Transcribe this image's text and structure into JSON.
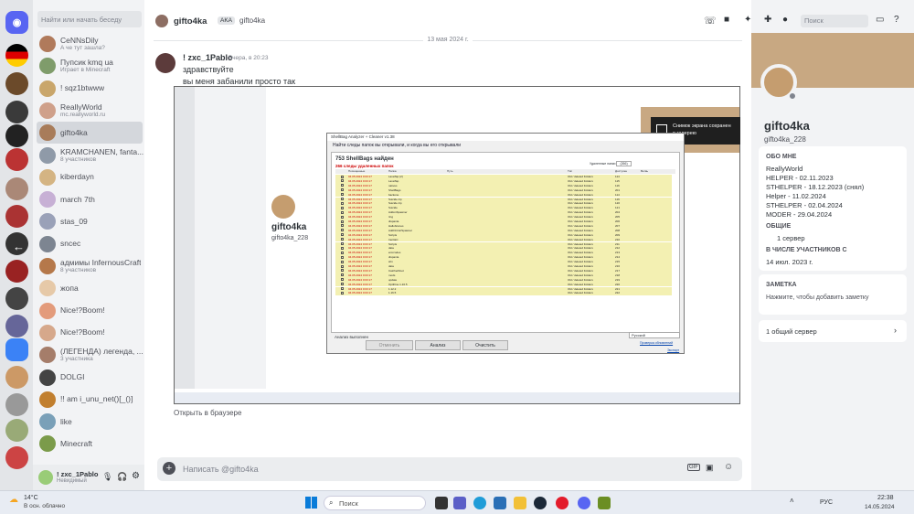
{
  "dm_list": {
    "search_placeholder": "Найти или начать беседу",
    "items": [
      {
        "name": "CeNNsDily",
        "sub": "А че тут зашла?"
      },
      {
        "name": "Пупсик kmq ua",
        "sub": "Играет в Minecraft"
      },
      {
        "name": "! sqz1btwww",
        "sub": ""
      },
      {
        "name": "ReallyWorld",
        "sub": "mc.reallyworld.ru"
      },
      {
        "name": "gifto4ka",
        "sub": ""
      },
      {
        "name": "KRAMCHANEN, fanta...",
        "sub": "8 участников"
      },
      {
        "name": "kiberdayn",
        "sub": ""
      },
      {
        "name": "march 7th",
        "sub": ""
      },
      {
        "name": "stas_09",
        "sub": ""
      },
      {
        "name": "sncec",
        "sub": ""
      },
      {
        "name": "адмимы InfernousCraft",
        "sub": "8 участников"
      },
      {
        "name": "жопа",
        "sub": ""
      },
      {
        "name": "Nice!?Boom!",
        "sub": ""
      },
      {
        "name": "Nice!?Boom!",
        "sub": ""
      },
      {
        "name": "(ЛЕГЕНДА) легенда, ...",
        "sub": "3 участника"
      },
      {
        "name": "DOLGI",
        "sub": ""
      },
      {
        "name": "!! am i_unu_net()[_()]",
        "sub": ""
      },
      {
        "name": "like",
        "sub": ""
      },
      {
        "name": "Minecraft",
        "sub": ""
      }
    ],
    "user_name": "! zxc_1Pablo",
    "user_status": "Невидимый"
  },
  "header": {
    "channel_name": "gifto4ka",
    "aka_label": "AKA",
    "aka_name": "gifto4ka",
    "search_placeholder": "Поиск"
  },
  "chat": {
    "date_divider": "13 мая 2024 г.",
    "author": "! zxc_1Pablo",
    "timestamp": "Вчера, в 20:23",
    "line1": "здравствуйте",
    "line2": "вы меня забанили просто так",
    "composer_placeholder": "Написать @gifto4ka",
    "open_in_browser": "Открыть в браузере"
  },
  "profile": {
    "display_name": "gifto4ka",
    "username": "gifto4ka_228",
    "about_title": "ОБО МНЕ",
    "about_lines": [
      "ReallyWorld",
      "HELPER - 02.11.2023",
      "STHELPER - 18.12.2023 (снял)",
      "Helper - 11.02.2024",
      "STHELPER - 02.04.2024",
      "MODER - 29.04.2024"
    ],
    "common_title": "ОБЩИЕ",
    "common_server": "1 сервер",
    "member_since_title": "В ЧИСЛЕ УЧАСТНИКОВ С",
    "member_since": "14 июл. 2023 г.",
    "note_title": "ЗАМЕТКА",
    "note_placeholder": "Нажмите, чтобы добавить заметку",
    "mutual_servers": "1 общий сервер"
  },
  "screenshot_toast": {
    "line1": "Снимок экрана сохранен",
    "line2": "в галерею"
  },
  "shellbag": {
    "window_title": "ShellBag Analyzer + Cleaner v1.38",
    "subtitle": "Найти следы папок вы открывали, и когда вы его открывали",
    "found": "753 ShellBags найден",
    "deleted": "266 следы удаленных папок",
    "deleted_label": "Удаленные папки",
    "deleted_count": "(266)",
    "columns": [
      "Посещенные",
      "Папка",
      "Путь",
      "Тип",
      "Доступен",
      "Ветвь"
    ],
    "rows": [
      {
        "date": "04.05.2024 0:03:17",
        "folder": "LavaTap (2)",
        "type": "Old / deleted Folders",
        "n": "114"
      },
      {
        "date": "04.05.2024 0:03:17",
        "folder": "LavaTap",
        "type": "Old / deleted Folders",
        "n": "115"
      },
      {
        "date": "04.05.2024 0:03:17",
        "folder": "natives",
        "type": "Old / deleted Folders",
        "n": "116"
      },
      {
        "date": "04.05.2024 0:03:17",
        "folder": "ShellBags",
        "type": "Old / deleted Folders",
        "n": "201"
      },
      {
        "date": "04.05.2024 0:03:17",
        "folder": "backone",
        "type": "Old / deleted Folders",
        "n": "114"
      },
      {
        "date": "04.05.2024 0:03:17",
        "folder": "Suicide.zip",
        "type": "Old / deleted Folders",
        "n": "119"
      },
      {
        "date": "04.05.2024 0:03:17",
        "folder": "Suicide.zip",
        "type": "Old / deleted Folders",
        "n": "120"
      },
      {
        "date": "04.05.2024 0:03:17",
        "folder": "Suicide",
        "type": "Old / deleted Folders",
        "n": "121"
      },
      {
        "date": "04.05.2024 0:03:17",
        "folder": "AddonSpawner",
        "type": "Old / deleted Folders",
        "n": "204"
      },
      {
        "date": "04.05.2024 0:03:17",
        "folder": "ring",
        "type": "Old / deleted Folders",
        "n": "205"
      },
      {
        "date": "04.05.2024 0:03:17",
        "folder": "dispanta",
        "type": "Old / deleted Folders",
        "n": "206"
      },
      {
        "date": "04.05.2024 0:03:17",
        "folder": "Hallofstones",
        "type": "Old / deleted Folders",
        "n": "207"
      },
      {
        "date": "04.05.2024 0:03:17",
        "folder": "AddOnCarSpawner",
        "type": "Old / deleted Folders",
        "n": "208"
      },
      {
        "date": "04.05.2024 0:03:17",
        "folder": "Scripts",
        "type": "Old / deleted Folders",
        "n": "209"
      },
      {
        "date": "04.05.2024 0:03:17",
        "folder": "InertiaC",
        "type": "Old / deleted Folders",
        "n": "210"
      },
      {
        "date": "04.05.2024 0:03:17",
        "folder": "Scripts",
        "type": "Old / deleted Folders",
        "n": "211"
      },
      {
        "date": "04.05.2024 0:03:17",
        "folder": "data",
        "type": "Old / deleted Folders",
        "n": "212"
      },
      {
        "date": "04.05.2024 0:03:17",
        "folder": "erorcodes",
        "type": "Old / deleted Folders",
        "n": "213"
      },
      {
        "date": "04.05.2024 0:03:17",
        "folder": "dispanta",
        "type": "Old / deleted Folders",
        "n": "214"
      },
      {
        "date": "04.05.2024 0:03:17",
        "folder": "sfm",
        "type": "Old / deleted Folders",
        "n": "215"
      },
      {
        "date": "04.05.2024 0:03:17",
        "folder": "data",
        "type": "Old / deleted Folders",
        "n": "216"
      },
      {
        "date": "04.05.2024 0:03:17",
        "folder": "CatcherRoot",
        "type": "Old / deleted Folders",
        "n": "217"
      },
      {
        "date": "04.05.2024 0:03:17",
        "folder": "mods",
        "type": "Old / deleted Folders",
        "n": "218"
      },
      {
        "date": "04.05.2024 0:03:17",
        "folder": "update",
        "type": "Old / deleted Folders",
        "n": "219"
      },
      {
        "date": "04.05.2024 0:03:17",
        "folder": "OptiFine 1.16.5",
        "type": "Old / deleted Folders",
        "n": "220"
      },
      {
        "date": "04.05.2024 0:03:17",
        "folder": "1.12.2",
        "type": "Old / deleted Folders",
        "n": "221"
      },
      {
        "date": "04.05.2024 0:03:17",
        "folder": "1.16.5",
        "type": "Old / deleted Folders",
        "n": "222"
      }
    ],
    "status": "Анализ выполнен",
    "btn_cancel": "Отменить",
    "btn_analyze": "Анализ",
    "btn_clean": "Очистить",
    "language": "Русский",
    "check_updates": "Проверка обновлений",
    "export": "Экспорт"
  },
  "taskbar": {
    "weather_temp": "14°C",
    "weather_desc": "В осн. облачно",
    "search_placeholder": "Поиск",
    "lang": "РУС",
    "time": "22:38",
    "date": "14.05.2024"
  },
  "colors": {
    "discord_blurple": "#5865f2",
    "row_highlight": "#f3f0b2",
    "deleted_red": "#cc0000",
    "online_green": "#23a55a"
  }
}
